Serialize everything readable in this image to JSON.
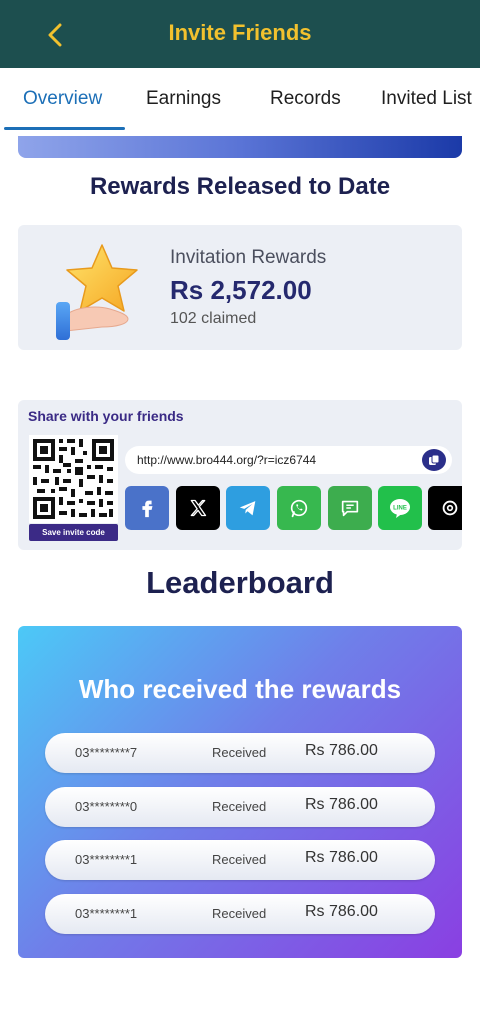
{
  "header": {
    "title": "Invite Friends"
  },
  "tabs": [
    {
      "label": "Overview",
      "active": true
    },
    {
      "label": "Earnings",
      "active": false
    },
    {
      "label": "Records",
      "active": false
    },
    {
      "label": "Invited List",
      "active": false
    }
  ],
  "rewards": {
    "section_title": "Rewards Released to Date",
    "label": "Invitation Rewards",
    "amount": "Rs 2,572.00",
    "claimed": "102 claimed"
  },
  "share": {
    "title": "Share with your friends",
    "save_label": "Save invite code",
    "url": "http://www.bro444.org/?r=icz6744",
    "buttons": [
      {
        "name": "facebook",
        "icon": "facebook-icon",
        "color": "#4a72c9"
      },
      {
        "name": "x",
        "icon": "x-icon",
        "color": "#000000"
      },
      {
        "name": "telegram",
        "icon": "telegram-icon",
        "color": "#2e9ee0"
      },
      {
        "name": "whatsapp",
        "icon": "whatsapp-icon",
        "color": "#37b84f"
      },
      {
        "name": "sms",
        "icon": "message-icon",
        "color": "#3dad4e"
      },
      {
        "name": "line",
        "icon": "line-icon",
        "color": "#22c04b"
      },
      {
        "name": "threads",
        "icon": "threads-icon",
        "color": "#000000"
      }
    ]
  },
  "leaderboard": {
    "section_title": "Leaderboard",
    "card_title": "Who received the rewards",
    "rows": [
      {
        "phone": "03********7",
        "status": "Received",
        "amount": "Rs 786.00"
      },
      {
        "phone": "03********0",
        "status": "Received",
        "amount": "Rs 786.00"
      },
      {
        "phone": "03********1",
        "status": "Received",
        "amount": "Rs 786.00"
      },
      {
        "phone": "03********1",
        "status": "Received",
        "amount": "Rs 786.00"
      }
    ]
  },
  "colors": {
    "header_bg": "#1d4f4f",
    "header_title": "#f2c12e",
    "tab_active": "#1c6fb7",
    "title_dark": "#1d2150"
  }
}
